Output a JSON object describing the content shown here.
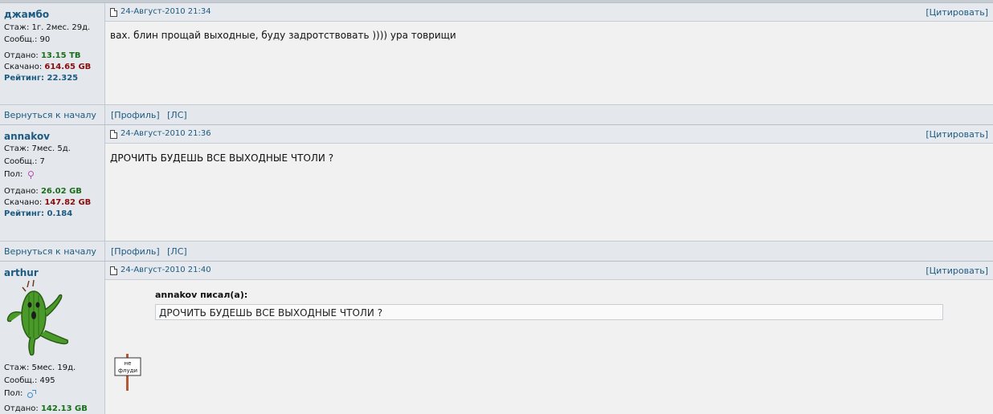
{
  "posts": [
    {
      "username": "джамбо",
      "stazh": "Стаж: 1г. 2мес. 29д.",
      "soobsch": "Сообщ.: 90",
      "otdano_label": "Отдано: ",
      "otdano_value": "13.15 TB",
      "skachano_label": "Скачано: ",
      "skachano_value": "614.65 GB",
      "rating_label": "Рейтинг: ",
      "rating_value": "22.325",
      "date": "24-Август-2010 21:34",
      "quote_btn": "[Цитировать]",
      "text": "вах. блин прощай выходные, буду задротствовать )))) ура товрищи"
    },
    {
      "username": "annakov",
      "stazh": "Стаж: 7мес. 5д.",
      "soobsch": "Сообщ.: 7",
      "pol": "Пол:",
      "gender_icon": "female-icon",
      "otdano_label": "Отдано: ",
      "otdano_value": "26.02 GB",
      "skachano_label": "Скачано: ",
      "skachano_value": "147.82 GB",
      "rating_label": "Рейтинг: ",
      "rating_value": "0.184",
      "date": "24-Август-2010 21:36",
      "quote_btn": "[Цитировать]",
      "text": "ДРОЧИТЬ БУДЕШЬ ВСЕ ВЫХОДНЫЕ ЧТОЛИ ?"
    },
    {
      "username": "arthur",
      "avatar_icon": "cactus-avatar-icon",
      "stazh": "Стаж: 5мес. 19д.",
      "soobsch": "Сообщ.: 495",
      "pol": "Пол:",
      "gender_icon": "male-icon",
      "otdano_label": "Отдано: ",
      "otdano_value": "142.13 GB",
      "date": "24-Август-2010 21:40",
      "quote_btn": "[Цитировать]",
      "quote_author": "annakov писал(а):",
      "quote_text": "ДРОЧИТЬ БУДЕШЬ ВСЕ ВЫХОДНЫЕ ЧТОЛИ ?",
      "sign_text_1": "не",
      "sign_text_2": "флуди"
    }
  ],
  "footer": {
    "back_to_top": "Вернуться к началу",
    "profile": "[Профиль]",
    "pm": "[ЛС]"
  }
}
